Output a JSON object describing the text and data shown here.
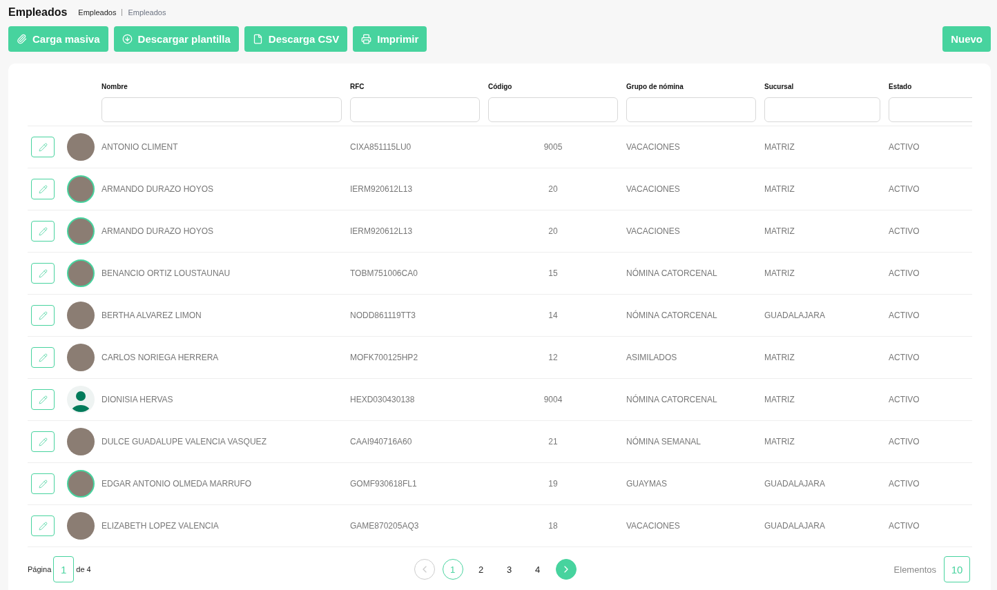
{
  "header": {
    "title": "Empleados",
    "breadcrumb": [
      {
        "label": "Empleados",
        "current": false
      },
      {
        "label": "Empleados",
        "current": true
      }
    ]
  },
  "toolbar": {
    "actions": [
      {
        "label": "Carga masiva",
        "kind": "attach"
      },
      {
        "label": "Descargar plantilla",
        "kind": "download"
      },
      {
        "label": "Descarga CSV",
        "kind": "file"
      },
      {
        "label": "Imprimir",
        "kind": "print"
      }
    ],
    "primary": "Nuevo"
  },
  "table": {
    "columns": [
      "Nombre",
      "RFC",
      "Código",
      "Grupo de nómina",
      "Sucursal",
      "Estado"
    ],
    "rows": [
      {
        "kind": "photo",
        "outlined": false,
        "cells": [
          "ANTONIO CLIMENT",
          "CIXA851115LU0",
          "9005",
          "VACACIONES",
          "MATRIZ",
          "ACTIVO"
        ]
      },
      {
        "kind": "photo",
        "outlined": true,
        "cells": [
          "ARMANDO DURAZO HOYOS",
          "IERM920612L13",
          "20",
          "VACACIONES",
          "MATRIZ",
          "ACTIVO"
        ]
      },
      {
        "kind": "photo",
        "outlined": true,
        "cells": [
          "ARMANDO DURAZO HOYOS",
          "IERM920612L13",
          "20",
          "VACACIONES",
          "MATRIZ",
          "ACTIVO"
        ]
      },
      {
        "kind": "photo",
        "outlined": true,
        "cells": [
          "BENANCIO ORTIZ LOUSTAUNAU",
          "TOBM751006CA0",
          "15",
          "NÓMINA CATORCENAL",
          "MATRIZ",
          "ACTIVO"
        ]
      },
      {
        "kind": "photo",
        "outlined": false,
        "cells": [
          "BERTHA ALVAREZ LIMON",
          "NODD861119TT3",
          "14",
          "NÓMINA CATORCENAL",
          "GUADALAJARA",
          "ACTIVO"
        ]
      },
      {
        "kind": "photo",
        "outlined": false,
        "cells": [
          "CARLOS NORIEGA HERRERA",
          "MOFK700125HP2",
          "12",
          "ASIMILADOS",
          "MATRIZ",
          "ACTIVO"
        ]
      },
      {
        "kind": "silhouette",
        "outlined": false,
        "cells": [
          "DIONISIA HERVAS",
          "HEXD030430138",
          "9004",
          "NÓMINA CATORCENAL",
          "MATRIZ",
          "ACTIVO"
        ]
      },
      {
        "kind": "photo",
        "outlined": false,
        "cells": [
          "DULCE GUADALUPE VALENCIA VASQUEZ",
          "CAAI940716A60",
          "21",
          "NÓMINA SEMANAL",
          "MATRIZ",
          "ACTIVO"
        ]
      },
      {
        "kind": "photo",
        "outlined": true,
        "cells": [
          "EDGAR ANTONIO OLMEDA MARRUFO",
          "GOMF930618FL1",
          "19",
          "GUAYMAS",
          "GUADALAJARA",
          "ACTIVO"
        ]
      },
      {
        "kind": "photo",
        "outlined": false,
        "cells": [
          "ELIZABETH LOPEZ VALENCIA",
          "GAME870205AQ3",
          "18",
          "VACACIONES",
          "GUADALAJARA",
          "ACTIVO"
        ]
      }
    ]
  },
  "footer": {
    "page_label": "Página",
    "page_value": "1",
    "page_total": "de 4",
    "prev_disabled": true,
    "next_disabled": false,
    "pages": [
      {
        "label": "1",
        "selected": true
      },
      {
        "label": "2",
        "selected": false
      },
      {
        "label": "3",
        "selected": false
      },
      {
        "label": "4",
        "selected": false
      }
    ],
    "elements_label": "Elementos",
    "elements_value": "10"
  }
}
